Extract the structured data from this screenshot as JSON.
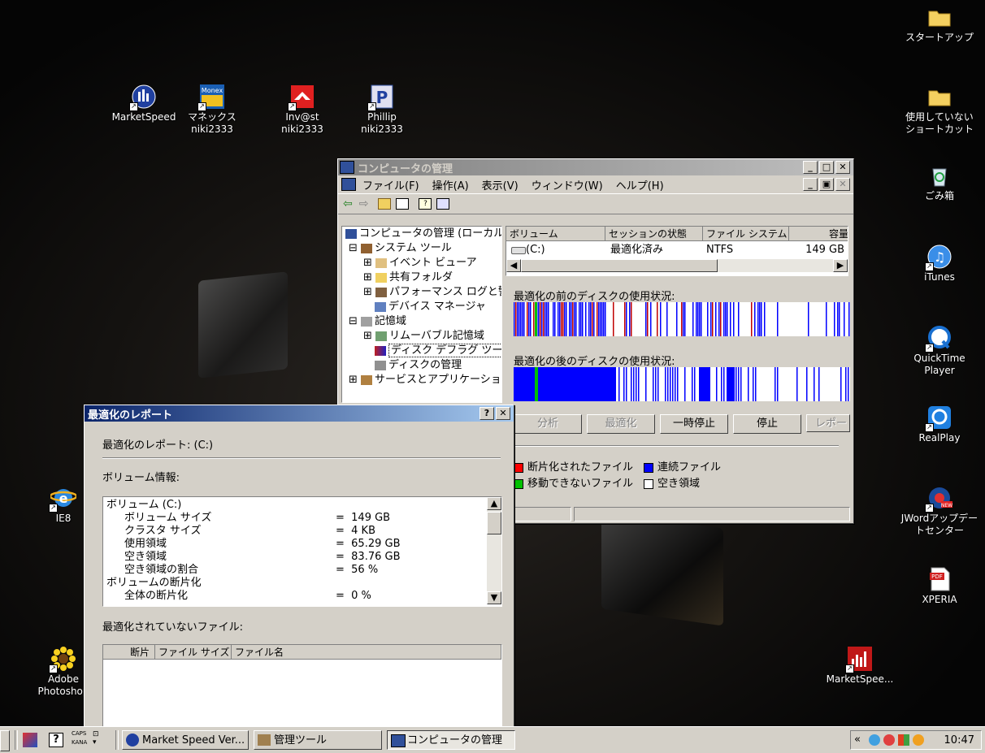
{
  "desktop_icons": [
    {
      "label": "MarketSpeed",
      "label2": ""
    },
    {
      "label": "マネックス",
      "label2": "niki2333"
    },
    {
      "label": "Inv@st",
      "label2": "niki2333"
    },
    {
      "label": "Phillip",
      "label2": "niki2333"
    },
    {
      "label": "スタートアップ",
      "label2": ""
    },
    {
      "label": "使用していない",
      "label2": "ショートカット"
    },
    {
      "label": "ごみ箱",
      "label2": ""
    },
    {
      "label": "iTunes",
      "label2": ""
    },
    {
      "label": "QuickTime",
      "label2": "Player"
    },
    {
      "label": "RealPlay",
      "label2": ""
    },
    {
      "label": "JWordアップデー",
      "label2": "トセンター"
    },
    {
      "label": "XPERIA",
      "label2": ""
    },
    {
      "label": "IE8",
      "label2": ""
    },
    {
      "label": "Adobe",
      "label2": "Photoshop"
    },
    {
      "label": "MarketSpee...",
      "label2": ""
    }
  ],
  "mmc": {
    "title": "コンピュータの管理",
    "menu": [
      "ファイル(F)",
      "操作(A)",
      "表示(V)",
      "ウィンドウ(W)",
      "ヘルプ(H)"
    ],
    "tree": [
      "コンピュータの管理 (ローカル)",
      "システム ツール",
      "イベント ビューア",
      "共有フォルダ",
      "パフォーマンス ログと警告",
      "デバイス マネージャ",
      "記憶域",
      "リムーバブル記憶域",
      "ディスク デフラグ ツール",
      "ディスクの管理",
      "サービスとアプリケーション"
    ],
    "columns": [
      "ボリューム",
      "セッションの状態",
      "ファイル システム",
      "容量"
    ],
    "row": {
      "volume": "(C:)",
      "state": "最適化済み",
      "fs": "NTFS",
      "capacity": "149 GB"
    },
    "before_label": "最適化の前のディスクの使用状況:",
    "after_label": "最適化の後のディスクの使用状況:",
    "buttons": [
      "分析",
      "最適化",
      "一時停止",
      "停止",
      "レポート"
    ],
    "legend": [
      {
        "label": "断片化されたファイル",
        "color": "#ff0000"
      },
      {
        "label": "連続ファイル",
        "color": "#0000ff"
      },
      {
        "label": "移動できないファイル",
        "color": "#00c000"
      },
      {
        "label": "空き領域",
        "color": "#ffffff"
      }
    ]
  },
  "report": {
    "title": "最適化のレポート",
    "heading": "最適化のレポート: (C:)",
    "volume_info_label": "ボリューム情報:",
    "lines": [
      {
        "k": "ボリューム (C:)",
        "v": "",
        "indent": false
      },
      {
        "k": "ボリューム サイズ",
        "v": "=  149 GB",
        "indent": true
      },
      {
        "k": "クラスタ サイズ",
        "v": "=  4 KB",
        "indent": true
      },
      {
        "k": "使用領域",
        "v": "=  65.29 GB",
        "indent": true
      },
      {
        "k": "空き領域",
        "v": "=  83.76 GB",
        "indent": true
      },
      {
        "k": "空き領域の割合",
        "v": "=  56 %",
        "indent": true
      },
      {
        "k": "ボリュームの断片化",
        "v": "",
        "indent": false
      },
      {
        "k": "全体の断片化",
        "v": "=  0 %",
        "indent": true
      }
    ],
    "not_defrag_label": "最適化されていないファイル:",
    "file_columns": [
      "断片",
      "ファイル サイズ",
      "ファイル名"
    ]
  },
  "taskbar": {
    "tasks": [
      "Market Speed Ver...",
      "管理ツール",
      "コンピュータの管理"
    ],
    "caps": "CAPS",
    "kana": "KANA",
    "clock": "10:47"
  }
}
